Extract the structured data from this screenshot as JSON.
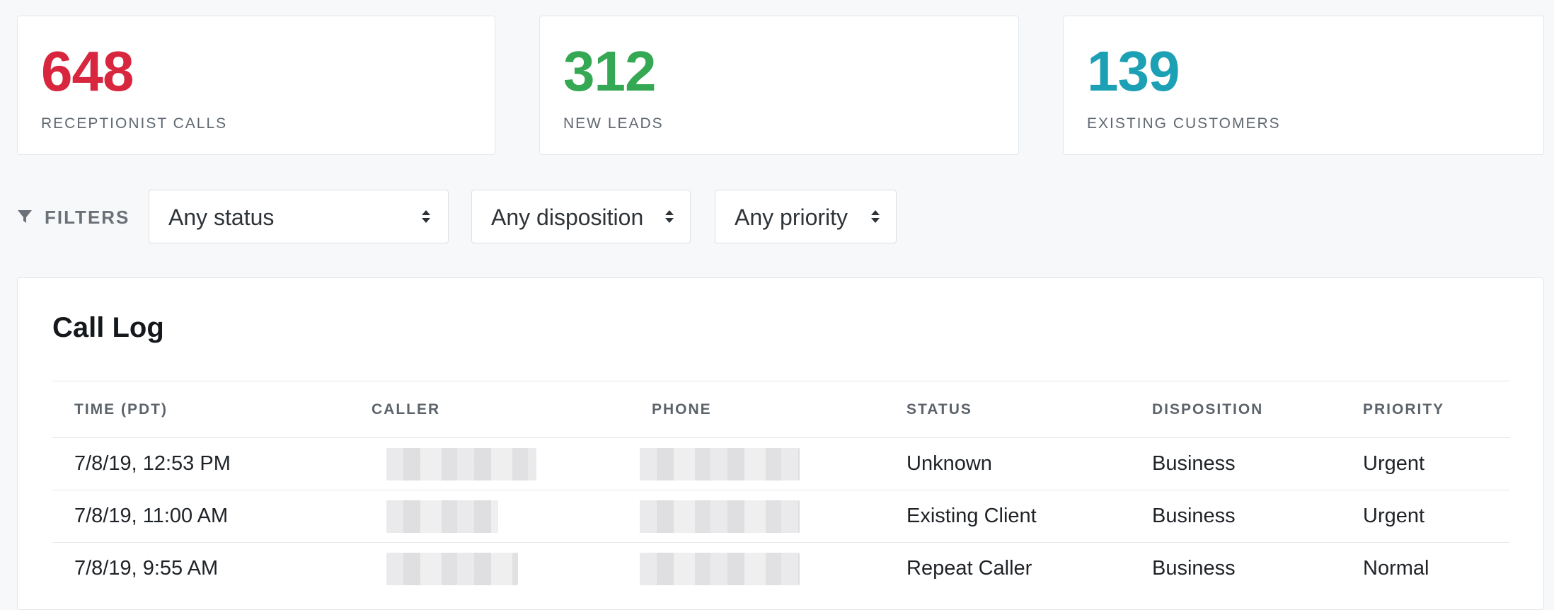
{
  "stats": [
    {
      "value": "648",
      "label": "RECEPTIONIST CALLS",
      "color": "#d7263d"
    },
    {
      "value": "312",
      "label": "NEW LEADS",
      "color": "#34a853"
    },
    {
      "value": "139",
      "label": "EXISTING CUSTOMERS",
      "color": "#1ba0b4"
    }
  ],
  "filters": {
    "label": "FILTERS",
    "icon": "funnel-icon",
    "status": "Any status",
    "disposition": "Any disposition",
    "priority": "Any priority"
  },
  "call_log": {
    "title": "Call Log",
    "columns": [
      "TIME (PDT)",
      "CALLER",
      "PHONE",
      "STATUS",
      "DISPOSITION",
      "PRIORITY"
    ],
    "rows": [
      {
        "time": "7/8/19, 12:53 PM",
        "status": "Unknown",
        "disposition": "Business",
        "priority": "Urgent"
      },
      {
        "time": "7/8/19, 11:00 AM",
        "status": "Existing Client",
        "disposition": "Business",
        "priority": "Urgent"
      },
      {
        "time": "7/8/19, 9:55 AM",
        "status": "Repeat Caller",
        "disposition": "Business",
        "priority": "Normal"
      }
    ]
  }
}
